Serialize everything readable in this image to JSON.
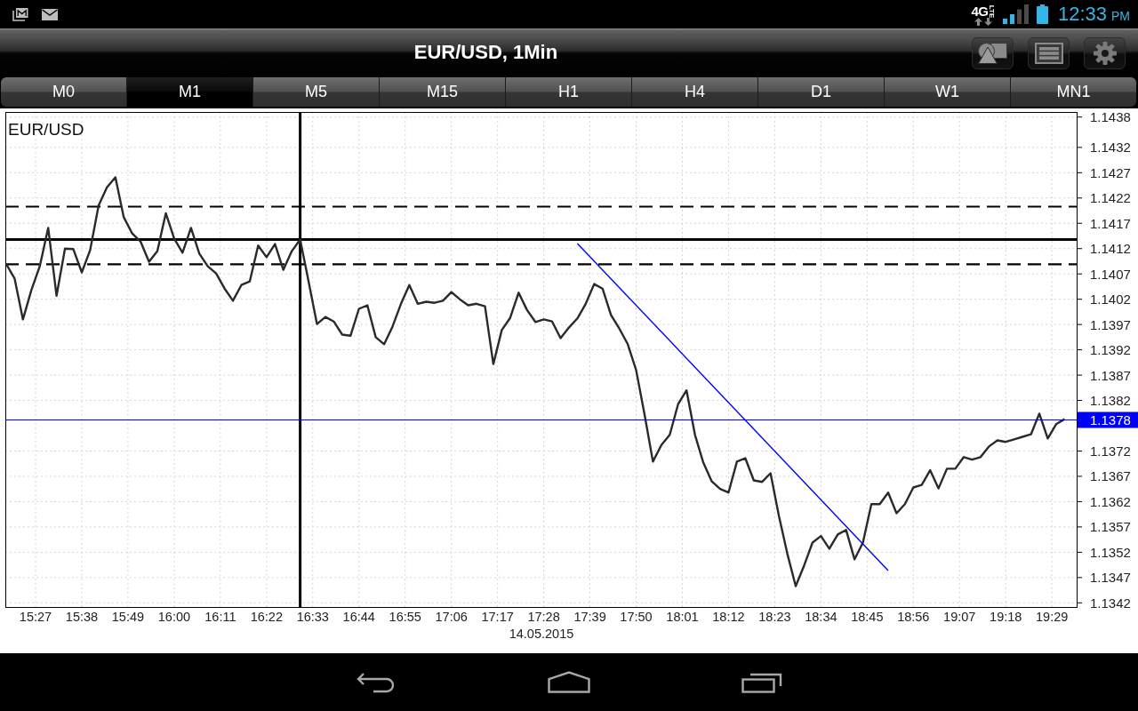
{
  "status_bar": {
    "network": "4G",
    "network_sub": "LTE",
    "time": "12:33",
    "period": "PM"
  },
  "title_bar": {
    "title": "EUR/USD, 1Min"
  },
  "tabs": [
    {
      "label": "M0",
      "selected": false
    },
    {
      "label": "M1",
      "selected": true
    },
    {
      "label": "M5",
      "selected": false
    },
    {
      "label": "M15",
      "selected": false
    },
    {
      "label": "H1",
      "selected": false
    },
    {
      "label": "H4",
      "selected": false
    },
    {
      "label": "D1",
      "selected": false
    },
    {
      "label": "W1",
      "selected": false
    },
    {
      "label": "MN1",
      "selected": false
    }
  ],
  "chart": {
    "chart_data": {
      "type": "line",
      "title": "EUR/USD",
      "xlabel": "14.05.2015",
      "grid": true,
      "x": [
        920,
        922,
        924,
        926,
        928,
        930,
        932,
        934,
        936,
        938,
        940,
        942,
        944,
        946,
        948,
        950,
        952,
        954,
        956,
        958,
        960,
        962,
        964,
        966,
        968,
        970,
        972,
        974,
        976,
        978,
        980,
        982,
        984,
        986,
        988,
        990,
        992,
        994,
        996,
        998,
        1000,
        1002,
        1004,
        1006,
        1008,
        1010,
        1012,
        1014,
        1016,
        1018,
        1020,
        1022,
        1024,
        1026,
        1028,
        1030,
        1032,
        1034,
        1036,
        1038,
        1040,
        1042,
        1044,
        1046,
        1048,
        1050,
        1052,
        1054,
        1056,
        1058,
        1060,
        1062,
        1064,
        1066,
        1068,
        1070,
        1072,
        1074,
        1076,
        1078,
        1080,
        1082,
        1084,
        1086,
        1088,
        1090,
        1092,
        1094,
        1096,
        1098,
        1100,
        1102,
        1104,
        1106,
        1108,
        1110,
        1112,
        1114,
        1116,
        1118,
        1120,
        1122,
        1124,
        1126,
        1128,
        1130,
        1132,
        1134,
        1136,
        1138,
        1140,
        1142,
        1144,
        1146,
        1148,
        1150,
        1152,
        1154,
        1156,
        1158,
        1160,
        1162,
        1164,
        1166,
        1168,
        1170,
        1172
      ],
      "series": [
        {
          "color": "#2a2a2a",
          "values": [
            1.1409,
            1.14061,
            1.1398,
            1.14038,
            1.14085,
            1.14161,
            1.14027,
            1.1412,
            1.14119,
            1.14073,
            1.14117,
            1.14205,
            1.14241,
            1.14261,
            1.14182,
            1.1415,
            1.14134,
            1.14094,
            1.14115,
            1.1419,
            1.1414,
            1.14112,
            1.14161,
            1.1411,
            1.14085,
            1.14071,
            1.14041,
            1.14017,
            1.14048,
            1.14055,
            1.14126,
            1.14103,
            1.14129,
            1.14078,
            1.14115,
            1.14138,
            1.14055,
            1.13971,
            1.13985,
            1.13976,
            1.1395,
            1.13948,
            1.14001,
            1.14008,
            1.13945,
            1.13931,
            1.13966,
            1.14011,
            1.14048,
            1.14011,
            1.14015,
            1.14013,
            1.14017,
            1.14034,
            1.1402,
            1.14008,
            1.14011,
            1.14006,
            1.13892,
            1.13959,
            1.13983,
            1.14033,
            1.13999,
            1.13975,
            1.1398,
            1.13976,
            1.13943,
            1.13964,
            1.13982,
            1.14011,
            1.1405,
            1.14041,
            1.13989,
            1.13962,
            1.13931,
            1.1388,
            1.13792,
            1.13699,
            1.13732,
            1.13752,
            1.13813,
            1.1384,
            1.13752,
            1.13697,
            1.1366,
            1.13645,
            1.13638,
            1.13699,
            1.13706,
            1.13662,
            1.13659,
            1.13676,
            1.13592,
            1.13517,
            1.13453,
            1.13494,
            1.13539,
            1.13552,
            1.13527,
            1.13555,
            1.13564,
            1.13506,
            1.13539,
            1.13615,
            1.13615,
            1.13638,
            1.13597,
            1.13615,
            1.13648,
            1.13653,
            1.13682,
            1.13646,
            1.13685,
            1.13685,
            1.13708,
            1.13703,
            1.13708,
            1.13729,
            1.13741,
            1.13738,
            1.13743,
            1.13748,
            1.13753,
            1.13794,
            1.13745,
            1.13773,
            1.13783
          ]
        },
        {
          "color": "#0000ff",
          "values": [
            null,
            null,
            null,
            null,
            null,
            null,
            null,
            null,
            null,
            null,
            null,
            null,
            null,
            null,
            null,
            null,
            null,
            null,
            null,
            null,
            null,
            null,
            null,
            null,
            null,
            null,
            null,
            null,
            null,
            null,
            null,
            null,
            null,
            null,
            null,
            null,
            null,
            null,
            null,
            null,
            null,
            null,
            null,
            null,
            null,
            null,
            null,
            null,
            null,
            null,
            null,
            null,
            null,
            null,
            null,
            null,
            null,
            null,
            null,
            null,
            null,
            null,
            null,
            null,
            null,
            null,
            null,
            null,
            1.1413,
            null,
            null,
            null,
            null,
            null,
            null,
            null,
            null,
            null,
            null,
            null,
            null,
            null,
            null,
            null,
            null,
            null,
            null,
            null,
            null,
            null,
            null,
            null,
            null,
            null,
            null,
            null,
            null,
            null,
            null,
            null,
            null,
            null,
            null,
            null,
            null,
            1.13484,
            null,
            null,
            null,
            null,
            null,
            null,
            null,
            null,
            null,
            null,
            null,
            null,
            null,
            null,
            null,
            null,
            null,
            null,
            null,
            null,
            null
          ]
        }
      ],
      "xlim": [
        919.8,
        1175.1
      ],
      "ylim": [
        1.1341,
        1.1439
      ],
      "xticks": [
        {
          "value": 927,
          "label": "15:27"
        },
        {
          "value": 938,
          "label": "15:38"
        },
        {
          "value": 949,
          "label": "15:49"
        },
        {
          "value": 960,
          "label": "16:00"
        },
        {
          "value": 971,
          "label": "16:11"
        },
        {
          "value": 982,
          "label": "16:22"
        },
        {
          "value": 993,
          "label": "16:33"
        },
        {
          "value": 1004,
          "label": "16:44"
        },
        {
          "value": 1015,
          "label": "16:55"
        },
        {
          "value": 1026,
          "label": "17:06"
        },
        {
          "value": 1037,
          "label": "17:17"
        },
        {
          "value": 1048,
          "label": "17:28"
        },
        {
          "value": 1059,
          "label": "17:39"
        },
        {
          "value": 1070,
          "label": "17:50"
        },
        {
          "value": 1081,
          "label": "18:01"
        },
        {
          "value": 1092,
          "label": "18:12"
        },
        {
          "value": 1103,
          "label": "18:23"
        },
        {
          "value": 1114,
          "label": "18:34"
        },
        {
          "value": 1125,
          "label": "18:45"
        },
        {
          "value": 1136,
          "label": "18:56"
        },
        {
          "value": 1147,
          "label": "19:07"
        },
        {
          "value": 1158,
          "label": "19:18"
        },
        {
          "value": 1169,
          "label": "19:29"
        }
      ],
      "yticks": [
        1.1438,
        1.1432,
        1.1427,
        1.1422,
        1.1417,
        1.1412,
        1.1407,
        1.1402,
        1.1397,
        1.1392,
        1.1387,
        1.1382,
        1.1372,
        1.1367,
        1.1362,
        1.1357,
        1.1352,
        1.1347,
        1.1342
      ],
      "ref_lines": [
        {
          "axis": "y",
          "value": 1.14138,
          "color": "#000000"
        },
        {
          "axis": "x",
          "value": 990,
          "color": "#000000"
        },
        {
          "axis": "y",
          "value": 1.14203,
          "color": "#000000"
        },
        {
          "axis": "y",
          "value": 1.14089,
          "color": "#000000"
        },
        {
          "axis": "y",
          "value": 1.13782,
          "color": "#0000ff",
          "label": "1.1378"
        }
      ]
    }
  }
}
